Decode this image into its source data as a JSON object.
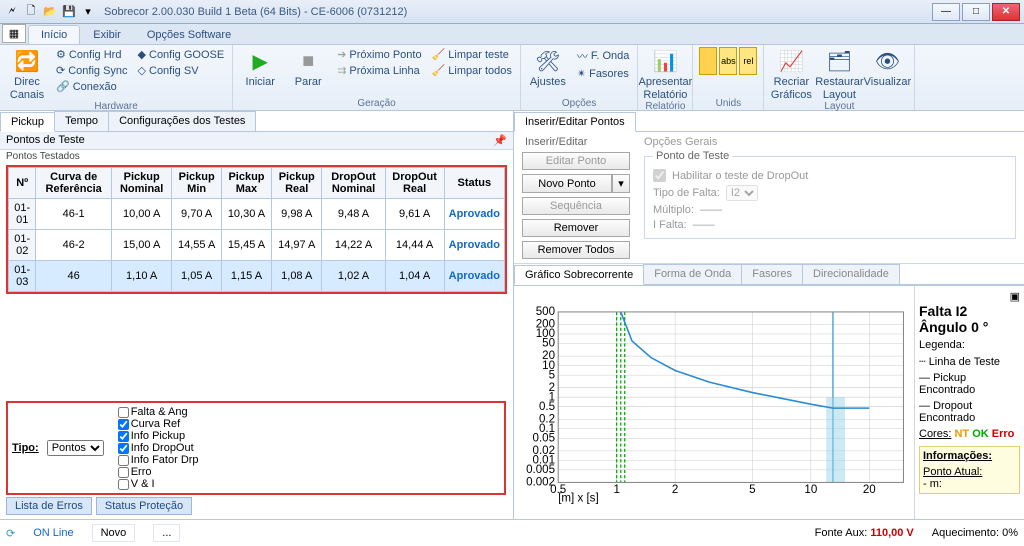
{
  "window": {
    "title": "Sobrecor 2.00.030 Build 1 Beta (64 Bits) - CE-6006 (0731212)"
  },
  "ribbonTabs": [
    "Início",
    "Exibir",
    "Opções Software"
  ],
  "groups": {
    "hw": {
      "cfgHrd": "Config Hrd",
      "cfgGoose": "Config GOOSE",
      "cfgSync": "Config Sync",
      "cfgSv": "Config SV",
      "direcCanais1": "Direc",
      "direcCanais2": "Canais",
      "conexao": "Conexão",
      "label": "Hardware"
    },
    "ger": {
      "iniciar": "Iniciar",
      "parar": "Parar",
      "proxPonto": "Próximo Ponto",
      "proxLinha": "Próxima Linha",
      "limparTeste": "Limpar teste",
      "limparTodos": "Limpar todos",
      "label": "Geração"
    },
    "opc": {
      "ajustes": "Ajustes",
      "fonda": "F. Onda",
      "fasores": "Fasores",
      "label": "Opções"
    },
    "rel": {
      "apresentar1": "Apresentar",
      "apresentar2": "Relatório",
      "label": "Relatório"
    },
    "unid": {
      "label": "Unids"
    },
    "lay": {
      "recriar1": "Recriar",
      "recriar2": "Gráficos",
      "restaurar1": "Restaurar",
      "restaurar2": "Layout",
      "visualizar": "Visualizar",
      "label": "Layout"
    }
  },
  "leftTabs": [
    "Pickup",
    "Tempo",
    "Configurações dos Testes"
  ],
  "panelTitle": "Pontos de Teste",
  "panelSub": "Pontos Testados",
  "columns": [
    "Nº",
    "Curva de Referência",
    "Pickup Nominal",
    "Pickup Min",
    "Pickup Max",
    "Pickup Real",
    "DropOut Nominal",
    "DropOut Real",
    "Status"
  ],
  "rows": [
    {
      "n": "01-01",
      "curva": "46-1",
      "pnom": "10,00 A",
      "pmin": "9,70 A",
      "pmax": "10,30 A",
      "preal": "9,98 A",
      "dnom": "9,48 A",
      "dreal": "9,61 A",
      "status": "Aprovado"
    },
    {
      "n": "01-02",
      "curva": "46-2",
      "pnom": "15,00 A",
      "pmin": "14,55 A",
      "pmax": "15,45 A",
      "preal": "14,97 A",
      "dnom": "14,22 A",
      "dreal": "14,44 A",
      "status": "Aprovado"
    },
    {
      "n": "01-03",
      "curva": "46",
      "pnom": "1,10 A",
      "pmin": "1,05 A",
      "pmax": "1,15 A",
      "preal": "1,08 A",
      "dnom": "1,02 A",
      "dreal": "1,04 A",
      "status": "Aprovado"
    }
  ],
  "filter": {
    "tipoLabel": "Tipo:",
    "tipoVal": "Pontos",
    "opts": [
      "Falta & Ang",
      "Curva Ref",
      "Info Pickup",
      "Info DropOut",
      "Info Fator Drp",
      "Erro",
      "V & I"
    ]
  },
  "bottomTabs": [
    "Lista de Erros",
    "Status Proteção"
  ],
  "insEdit": {
    "tab": "Inserir/Editar Pontos",
    "leg1": "Inserir/Editar",
    "leg2": "Opções Gerais",
    "editarPonto": "Editar Ponto",
    "novoPonto": "Novo Ponto",
    "sequencia": "Sequência",
    "remover": "Remover",
    "removerTodos": "Remover Todos",
    "pontoTeste": "Ponto de Teste",
    "habDrop": "Habilitar o teste de DropOut",
    "tipoFalta": "Tipo de Falta:",
    "tipoFaltaVal": "I2",
    "multiplo": "Múltiplo:",
    "ifalta": "I Falta:"
  },
  "graphTabs": [
    "Gráfico Sobrecorrente",
    "Forma de Onda",
    "Fasores",
    "Direcionalidade"
  ],
  "chart_data": {
    "type": "line",
    "xscale": "log",
    "yscale": "log",
    "xticks": [
      0.5,
      1.0,
      2.0,
      5.0,
      10,
      20
    ],
    "yticks": [
      500,
      200,
      100,
      50,
      20,
      10,
      5.0,
      2.0,
      1.0,
      0.5,
      0.2,
      0.1,
      0.05,
      0.02,
      0.01,
      0.005,
      0.002
    ],
    "xlabel": "[m] x [s]",
    "verticals": [
      1.0,
      1.05,
      1.1,
      13
    ],
    "curve": [
      {
        "x": 1.05,
        "y": 500
      },
      {
        "x": 1.2,
        "y": 60
      },
      {
        "x": 1.5,
        "y": 18
      },
      {
        "x": 2.0,
        "y": 7
      },
      {
        "x": 3.0,
        "y": 3
      },
      {
        "x": 5.0,
        "y": 1.4
      },
      {
        "x": 10,
        "y": 0.6
      },
      {
        "x": 13,
        "y": 0.45
      },
      {
        "x": 20,
        "y": 0.45
      }
    ]
  },
  "legend": {
    "title1": "Falta I2",
    "title2": "Ângulo 0 °",
    "hdr": "Legenda:",
    "l1": "Linha de Teste",
    "l2": "Pickup Encontrado",
    "l3": "Dropout Encontrado",
    "cores": "Cores:",
    "nt": "NT",
    "ok": "OK",
    "erro": "Erro",
    "info": "Informações:",
    "pa": "Ponto Atual:",
    "m": "- m:"
  },
  "status": {
    "online": "ON Line",
    "novo": "Novo",
    "dots": "...",
    "fonteLabel": "Fonte Aux:",
    "fonteVal": "110,00 V",
    "aquecLabel": "Aquecimento:",
    "aquecVal": "0%"
  }
}
